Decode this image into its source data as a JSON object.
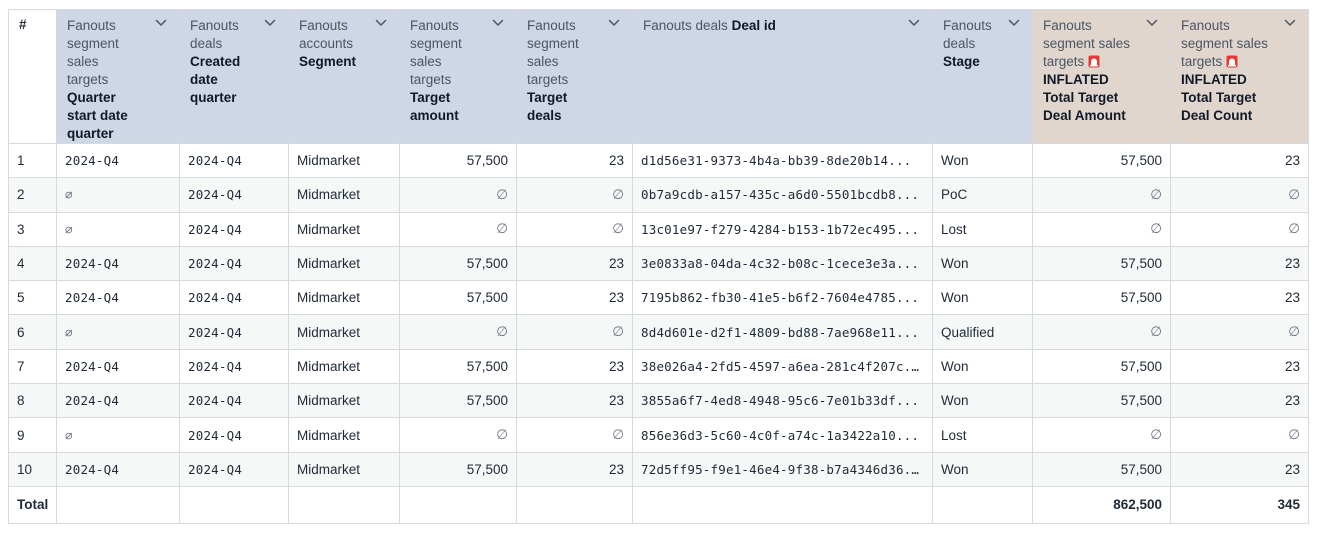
{
  "headers": [
    {
      "key": "idx",
      "light": [],
      "bold": [
        "#"
      ],
      "kind": "idx"
    },
    {
      "key": "qsq",
      "light": [
        "Fanouts",
        "segment",
        "sales",
        "targets"
      ],
      "bold": [
        "Quarter",
        "start date",
        "quarter"
      ],
      "kind": "dim"
    },
    {
      "key": "cdq",
      "light": [
        "Fanouts",
        "deals"
      ],
      "bold": [
        "Created",
        "date",
        "quarter"
      ],
      "kind": "dim"
    },
    {
      "key": "seg",
      "light": [
        "Fanouts",
        "accounts"
      ],
      "bold": [
        "Segment"
      ],
      "kind": "dim"
    },
    {
      "key": "tam",
      "light": [
        "Fanouts",
        "segment",
        "sales",
        "targets"
      ],
      "bold": [
        "Target",
        "amount"
      ],
      "kind": "dim"
    },
    {
      "key": "tde",
      "light": [
        "Fanouts",
        "segment",
        "sales",
        "targets"
      ],
      "bold": [
        "Target",
        "deals"
      ],
      "kind": "dim"
    },
    {
      "key": "did",
      "light": [
        "Fanouts deals"
      ],
      "bold": [
        "Deal id"
      ],
      "kind": "dim",
      "inline": true
    },
    {
      "key": "stg",
      "light": [
        "Fanouts",
        "deals"
      ],
      "bold": [
        "Stage"
      ],
      "kind": "dim"
    },
    {
      "key": "tda",
      "light": [
        "Fanouts",
        "segment sales",
        "targets"
      ],
      "bold": [
        "INFLATED",
        "Total Target",
        "Deal Amount"
      ],
      "kind": "meas",
      "siren": true
    },
    {
      "key": "tdc",
      "light": [
        "Fanouts",
        "segment sales",
        "targets"
      ],
      "bold": [
        "INFLATED",
        "Total Target",
        "Deal Count"
      ],
      "kind": "meas",
      "siren": true
    }
  ],
  "null_symbol": "∅",
  "rows": [
    [
      "1",
      "2024-Q4",
      "2024-Q4",
      "Midmarket",
      "57,500",
      "23",
      "d1d56e31-9373-4b4a-bb39-8de20b14...",
      "Won",
      "57,500",
      "23"
    ],
    [
      "2",
      null,
      "2024-Q4",
      "Midmarket",
      null,
      null,
      "0b7a9cdb-a157-435c-a6d0-5501bcdb8...",
      "PoC",
      null,
      null
    ],
    [
      "3",
      null,
      "2024-Q4",
      "Midmarket",
      null,
      null,
      "13c01e97-f279-4284-b153-1b72ec495...",
      "Lost",
      null,
      null
    ],
    [
      "4",
      "2024-Q4",
      "2024-Q4",
      "Midmarket",
      "57,500",
      "23",
      "3e0833a8-04da-4c32-b08c-1cece3e3a...",
      "Won",
      "57,500",
      "23"
    ],
    [
      "5",
      "2024-Q4",
      "2024-Q4",
      "Midmarket",
      "57,500",
      "23",
      "7195b862-fb30-41e5-b6f2-7604e4785...",
      "Won",
      "57,500",
      "23"
    ],
    [
      "6",
      null,
      "2024-Q4",
      "Midmarket",
      null,
      null,
      "8d4d601e-d2f1-4809-bd88-7ae968e11...",
      "Qualified",
      null,
      null
    ],
    [
      "7",
      "2024-Q4",
      "2024-Q4",
      "Midmarket",
      "57,500",
      "23",
      "38e026a4-2fd5-4597-a6ea-281c4f207c...",
      "Won",
      "57,500",
      "23"
    ],
    [
      "8",
      "2024-Q4",
      "2024-Q4",
      "Midmarket",
      "57,500",
      "23",
      "3855a6f7-4ed8-4948-95c6-7e01b33df...",
      "Won",
      "57,500",
      "23"
    ],
    [
      "9",
      null,
      "2024-Q4",
      "Midmarket",
      null,
      null,
      "856e36d3-5c60-4c0f-a74c-1a3422a10...",
      "Lost",
      null,
      null
    ],
    [
      "10",
      "2024-Q4",
      "2024-Q4",
      "Midmarket",
      "57,500",
      "23",
      "72d5ff95-f9e1-46e4-9f38-b7a4346d36...",
      "Won",
      "57,500",
      "23"
    ]
  ],
  "totals": {
    "label": "Total",
    "amount": "862,500",
    "count": "345"
  },
  "icons": {
    "sort": "chevron-down-icon",
    "warning": "siren-icon"
  },
  "colors": {
    "dimension_header": "#cdd7e6",
    "measure_header": "#e0d6cd",
    "siren": "#e53935"
  }
}
